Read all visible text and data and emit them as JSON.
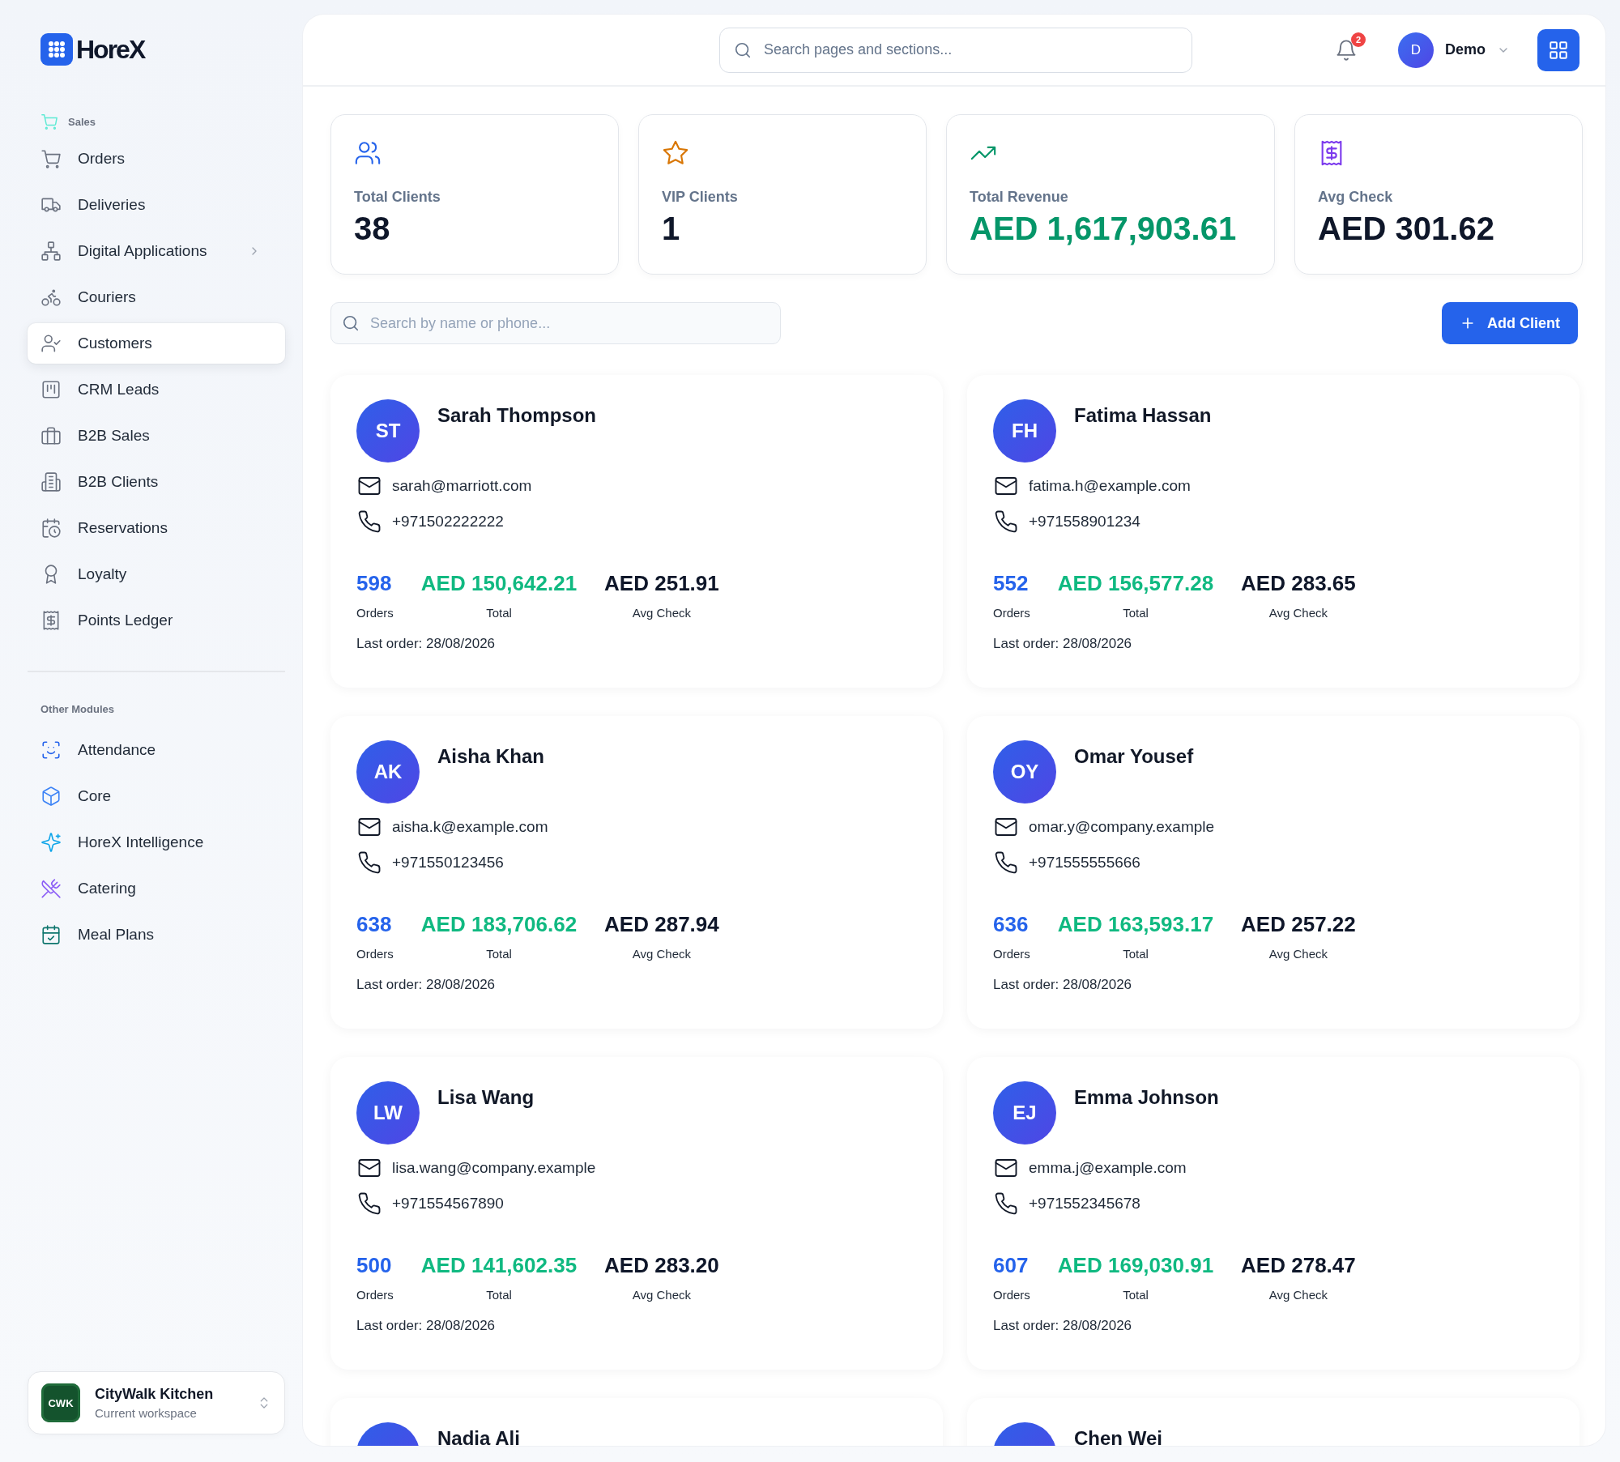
{
  "sidebar": {
    "logo": "HoreX",
    "sections": [
      {
        "title": "Sales",
        "items": [
          {
            "label": "Orders",
            "selected": false,
            "has_submenu": false
          },
          {
            "label": "Deliveries",
            "selected": false,
            "has_submenu": false
          },
          {
            "label": "Digital Applications",
            "selected": false,
            "has_submenu": true
          },
          {
            "label": "Couriers",
            "selected": false,
            "has_submenu": false
          },
          {
            "label": "Customers",
            "selected": true,
            "has_submenu": false
          },
          {
            "label": "CRM Leads",
            "selected": false,
            "has_submenu": false
          },
          {
            "label": "B2B Sales",
            "selected": false,
            "has_submenu": false
          },
          {
            "label": "B2B Clients",
            "selected": false,
            "has_submenu": false
          },
          {
            "label": "Reservations",
            "selected": false,
            "has_submenu": false
          },
          {
            "label": "Loyalty",
            "selected": false,
            "has_submenu": false
          },
          {
            "label": "Points Ledger",
            "selected": false,
            "has_submenu": false
          }
        ]
      },
      {
        "title": "Other Modules",
        "items": [
          {
            "label": "Attendance",
            "color": "#2563eb",
            "selected": false,
            "has_submenu": false
          },
          {
            "label": "Core",
            "color": "#3b82f6",
            "selected": false,
            "has_submenu": false
          },
          {
            "label": "HoreX Intelligence",
            "color": "#0ea5e9",
            "selected": false,
            "has_submenu": false
          },
          {
            "label": "Catering",
            "color": "#8b5cf6",
            "selected": false,
            "has_submenu": false
          },
          {
            "label": "Meal Plans",
            "color": "#0f766e",
            "selected": false,
            "has_submenu": false
          }
        ]
      }
    ],
    "workspace": {
      "badge": "CWK",
      "name": "CityWalk Kitchen",
      "subtitle": "Current workspace"
    }
  },
  "header": {
    "search": {
      "placeholder": "Search pages and sections..."
    },
    "notifications": "2",
    "user": {
      "initial": "D",
      "name": "Demo"
    }
  },
  "stats": [
    {
      "label": "Total Clients",
      "value": "38",
      "kind": "plain"
    },
    {
      "label": "VIP Clients",
      "value": "1",
      "kind": "plain"
    },
    {
      "label": "Total Revenue",
      "value": "AED 1,617,903.61",
      "kind": "money"
    },
    {
      "label": "Avg Check",
      "value": "AED 301.62",
      "kind": "plain"
    }
  ],
  "toolbar": {
    "search": {
      "placeholder": "Search by name or phone..."
    },
    "add_button": "Add Client"
  },
  "clients": [
    {
      "initials": "ST",
      "name": "Sarah Thompson",
      "email": "sarah@marriott.com",
      "phone": "+971502222222",
      "stats": [
        {
          "kind": "count",
          "value": "598",
          "label": "Orders"
        },
        {
          "kind": "total",
          "value": "AED 150,642.21",
          "label": "Total"
        },
        {
          "kind": "avg",
          "value": "AED 251.91",
          "label": "Avg Check"
        }
      ],
      "last_order": "Last order: 28/08/2026"
    },
    {
      "initials": "FH",
      "name": "Fatima Hassan",
      "email": "fatima.h@example.com",
      "phone": "+971558901234",
      "stats": [
        {
          "kind": "count",
          "value": "552",
          "label": "Orders"
        },
        {
          "kind": "total",
          "value": "AED 156,577.28",
          "label": "Total"
        },
        {
          "kind": "avg",
          "value": "AED 283.65",
          "label": "Avg Check"
        }
      ],
      "last_order": "Last order: 28/08/2026"
    },
    {
      "initials": "AK",
      "name": "Aisha Khan",
      "email": "aisha.k@example.com",
      "phone": "+971550123456",
      "stats": [
        {
          "kind": "count",
          "value": "638",
          "label": "Orders"
        },
        {
          "kind": "total",
          "value": "AED 183,706.62",
          "label": "Total"
        },
        {
          "kind": "avg",
          "value": "AED 287.94",
          "label": "Avg Check"
        }
      ],
      "last_order": "Last order: 28/08/2026"
    },
    {
      "initials": "OY",
      "name": "Omar Yousef",
      "email": "omar.y@company.example",
      "phone": "+971555555666",
      "stats": [
        {
          "kind": "count",
          "value": "636",
          "label": "Orders"
        },
        {
          "kind": "total",
          "value": "AED 163,593.17",
          "label": "Total"
        },
        {
          "kind": "avg",
          "value": "AED 257.22",
          "label": "Avg Check"
        }
      ],
      "last_order": "Last order: 28/08/2026"
    },
    {
      "initials": "LW",
      "name": "Lisa Wang",
      "email": "lisa.wang@company.example",
      "phone": "+971554567890",
      "stats": [
        {
          "kind": "count",
          "value": "500",
          "label": "Orders"
        },
        {
          "kind": "total",
          "value": "AED 141,602.35",
          "label": "Total"
        },
        {
          "kind": "avg",
          "value": "AED 283.20",
          "label": "Avg Check"
        }
      ],
      "last_order": "Last order: 28/08/2026"
    },
    {
      "initials": "EJ",
      "name": "Emma Johnson",
      "email": "emma.j@example.com",
      "phone": "+971552345678",
      "stats": [
        {
          "kind": "count",
          "value": "607",
          "label": "Orders"
        },
        {
          "kind": "total",
          "value": "AED 169,030.91",
          "label": "Total"
        },
        {
          "kind": "avg",
          "value": "AED 278.47",
          "label": "Avg Check"
        }
      ],
      "last_order": "Last order: 28/08/2026"
    },
    {
      "name": "Nadia Ali"
    },
    {
      "name": "Chen Wei"
    }
  ]
}
